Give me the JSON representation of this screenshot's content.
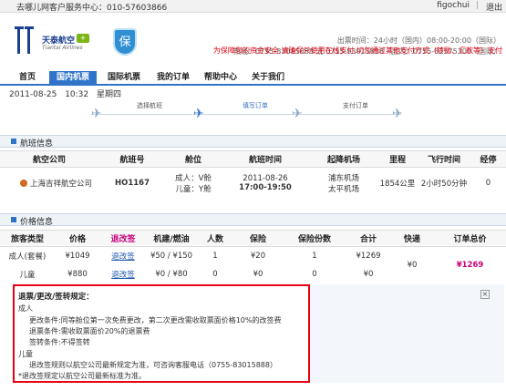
{
  "topbar": {
    "hotline": "去哪儿网客户服务中心：010-57603866",
    "user": "figochui",
    "sep": "|",
    "logout": "退出"
  },
  "header": {
    "logo_tt": "TT",
    "brand_cn": "天泰航空",
    "brand_plus": "+",
    "brand_en": "Tiantai Airlines",
    "badge": "保",
    "hours": "出票时间：24小时（国内）08:00-20:00（国际）",
    "phones": "热线：0755-83015888 或 0755-83015888（国内）0755-82575300（国际）",
    "warning": "为保障您的资金安全,请确保只使用在线支付,切勿通过其他支付方式（转账、汇款等）支付"
  },
  "nav": {
    "items": [
      "首页",
      "国内机票",
      "国际机票",
      "我的订单",
      "帮助中心",
      "关于我们"
    ],
    "active_index": 1
  },
  "datebar": {
    "date": "2011-08-25",
    "time": "10:32",
    "weekday": "星期四"
  },
  "steps": {
    "labels": [
      "选择航班",
      "填写订单",
      "支付订单"
    ],
    "current_index": 1,
    "plane_glyph": "✈"
  },
  "flight_section": {
    "title": "航班信息",
    "headers": [
      "航空公司",
      "航班号",
      "舱位",
      "航班时间",
      "起降机场",
      "里程",
      "飞行时间",
      "经停"
    ],
    "row": {
      "airline": "上海吉祥航空公司",
      "flight_no": "HO1167",
      "cabin_adult": "成人：V舱",
      "cabin_child": "儿童：Y舱",
      "date": "2011-08-26",
      "time": "17:00-19:50",
      "dep_airport": "浦东机场",
      "arr_airport": "太平机场",
      "distance": "1854公里",
      "duration": "2小时50分钟",
      "stops": "0"
    }
  },
  "price_section": {
    "title": "价格信息",
    "headers": [
      "旅客类型",
      "价格",
      "退改签",
      "机建/燃油",
      "人数",
      "保险",
      "保险份数",
      "合计",
      "快递",
      "订单总价"
    ],
    "rows": [
      {
        "type": "成人(套餐)",
        "price": "¥1049",
        "rule": "退改签",
        "tax": "¥50 / ¥150",
        "count": "1",
        "insurance": "¥20",
        "ins_count": "1",
        "total": "¥1269"
      },
      {
        "type": "儿童",
        "price": "¥880",
        "rule": "退改签",
        "tax": "¥0 / ¥80",
        "count": "0",
        "insurance": "¥0",
        "ins_count": "0",
        "total": "¥0"
      }
    ],
    "express": "¥0",
    "order_total": "¥1269"
  },
  "rules": {
    "title": "退票/更改/签转规定：",
    "adult_label": "成人",
    "adult_lines": [
      "更改条件:同等舱位第一次免费更改，第二次更改需收取票面价格10%的改签费",
      "退票条件:需收取票面价20%的退票费",
      "签转条件:不得签转"
    ],
    "child_label": "儿童",
    "child_line": "退改签规则以航空公司最新规定为准，可咨询客服电话（0755-83015888）",
    "note": "*退改签规定以航空公司最新标准为准。",
    "close": "×"
  },
  "colors": {
    "accent": "#2f74c8",
    "warning": "#e60012",
    "link": "#1b56b0",
    "highlight": "#c8007a"
  }
}
